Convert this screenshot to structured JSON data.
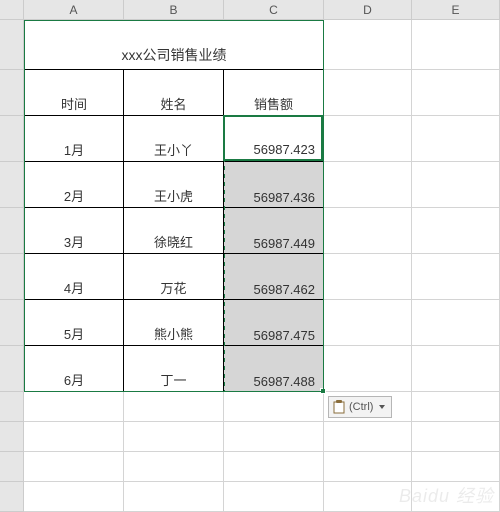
{
  "columns": {
    "A": "A",
    "B": "B",
    "C": "C",
    "D": "D",
    "E": "E"
  },
  "title": "xxx公司销售业绩",
  "headers": {
    "time": "时间",
    "name": "姓名",
    "sales": "销售额"
  },
  "rows": [
    {
      "time": "1月",
      "name": "王小丫",
      "sales": "56987.423"
    },
    {
      "time": "2月",
      "name": "王小虎",
      "sales": "56987.436"
    },
    {
      "time": "3月",
      "name": "徐晓红",
      "sales": "56987.449"
    },
    {
      "time": "4月",
      "name": "万花",
      "sales": "56987.462"
    },
    {
      "time": "5月",
      "name": "熊小熊",
      "sales": "56987.475"
    },
    {
      "time": "6月",
      "name": "丁一",
      "sales": "56987.488"
    }
  ],
  "paste_options": {
    "label": "(Ctrl)"
  },
  "watermark": "Baidu 经验",
  "active_value": "56987.423",
  "chart_data": {
    "type": "table",
    "title": "xxx公司销售业绩",
    "columns": [
      "时间",
      "姓名",
      "销售额"
    ],
    "rows": [
      [
        "1月",
        "王小丫",
        56987.423
      ],
      [
        "2月",
        "王小虎",
        56987.436
      ],
      [
        "3月",
        "徐晓红",
        56987.449
      ],
      [
        "4月",
        "万花",
        56987.462
      ],
      [
        "5月",
        "熊小熊",
        56987.475
      ],
      [
        "6月",
        "丁一",
        56987.488
      ]
    ]
  }
}
